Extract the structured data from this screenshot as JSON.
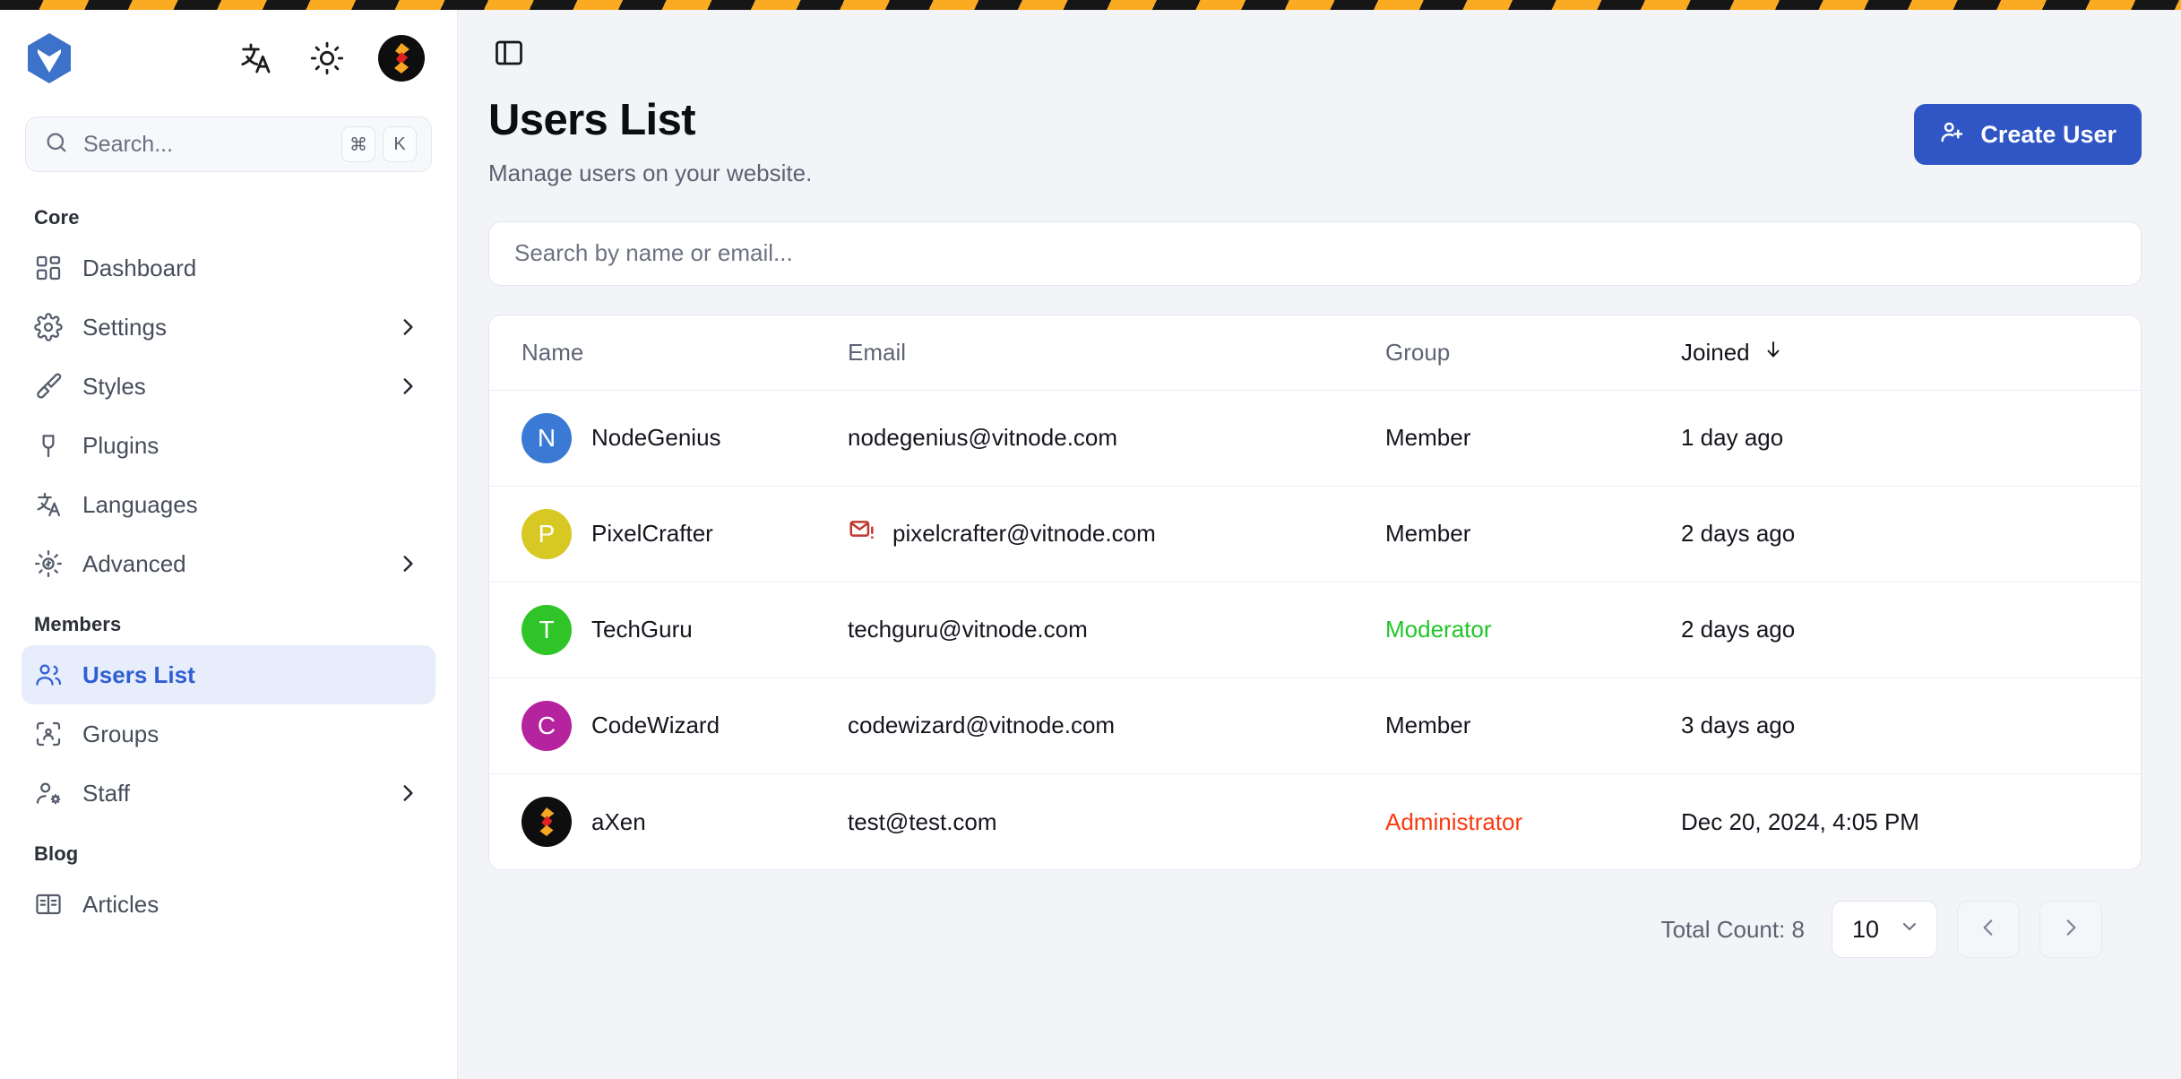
{
  "topbar": {
    "logo_icon": "vitnode-hexagon-logo",
    "translate_icon": "translate-icon",
    "theme_icon": "sun-icon",
    "avatar_icon": "user-avatar"
  },
  "sidebar": {
    "search": {
      "placeholder": "Search...",
      "kbd_mod": "⌘",
      "kbd_key": "K"
    },
    "groups": [
      {
        "label": "Core",
        "items": [
          {
            "label": "Dashboard",
            "icon": "layout-grid-icon",
            "active": false,
            "expandable": false
          },
          {
            "label": "Settings",
            "icon": "gear-icon",
            "active": false,
            "expandable": true
          },
          {
            "label": "Styles",
            "icon": "paintbrush-icon",
            "active": false,
            "expandable": true
          },
          {
            "label": "Plugins",
            "icon": "plug-icon",
            "active": false,
            "expandable": false
          },
          {
            "label": "Languages",
            "icon": "translate-icon",
            "active": false,
            "expandable": false
          },
          {
            "label": "Advanced",
            "icon": "cog-spokes-icon",
            "active": false,
            "expandable": true
          }
        ]
      },
      {
        "label": "Members",
        "items": [
          {
            "label": "Users List",
            "icon": "users-icon",
            "active": true,
            "expandable": false
          },
          {
            "label": "Groups",
            "icon": "group-frame-icon",
            "active": false,
            "expandable": false
          },
          {
            "label": "Staff",
            "icon": "user-cog-icon",
            "active": false,
            "expandable": true
          }
        ]
      },
      {
        "label": "Blog",
        "items": [
          {
            "label": "Articles",
            "icon": "book-open-icon",
            "active": false,
            "expandable": false
          }
        ]
      }
    ]
  },
  "main": {
    "panel_toggle_icon": "panel-left-icon",
    "title": "Users List",
    "subtitle": "Manage users on your website.",
    "create_button": {
      "label": "Create User",
      "icon": "user-plus-icon"
    },
    "search": {
      "placeholder": "Search by name or email..."
    }
  },
  "table": {
    "columns": [
      "Name",
      "Email",
      "Group",
      "Joined"
    ],
    "sort_column": "Joined",
    "sort_direction": "desc",
    "sort_icon": "arrow-down-icon",
    "action_icon": "eye-icon",
    "rows": [
      {
        "name": "NodeGenius",
        "initial": "N",
        "avatar_color": "#3b7ad4",
        "email": "nodegenius@vitnode.com",
        "email_warning": false,
        "group": "Member",
        "group_style": "member",
        "joined": "1 day ago"
      },
      {
        "name": "PixelCrafter",
        "initial": "P",
        "avatar_color": "#d8c824",
        "email": "pixelcrafter@vitnode.com",
        "email_warning": true,
        "email_warning_icon": "mail-warning-icon",
        "group": "Member",
        "group_style": "member",
        "joined": "2 days ago"
      },
      {
        "name": "TechGuru",
        "initial": "T",
        "avatar_color": "#2fc528",
        "email": "techguru@vitnode.com",
        "email_warning": false,
        "group": "Moderator",
        "group_style": "moderator",
        "joined": "2 days ago"
      },
      {
        "name": "CodeWizard",
        "initial": "C",
        "avatar_color": "#b5239e",
        "email": "codewizard@vitnode.com",
        "email_warning": false,
        "group": "Member",
        "group_style": "member",
        "joined": "3 days ago"
      },
      {
        "name": "aXen",
        "initial": "",
        "avatar_color": "#0e0e0e",
        "avatar_image": "axen-logo",
        "email": "test@test.com",
        "email_warning": false,
        "group": "Administrator",
        "group_style": "admin",
        "joined": "Dec 20, 2024, 4:05 PM"
      }
    ]
  },
  "pagination": {
    "total_label": "Total Count: 8",
    "page_size": "10",
    "prev_icon": "chevron-left-icon",
    "next_icon": "chevron-right-icon",
    "dropdown_icon": "chevron-down-icon"
  },
  "colors": {
    "accent": "#2f56c4",
    "active_nav_bg": "#e7edfb",
    "active_nav_text": "#2f5fd4",
    "moderator": "#22c52b",
    "administrator": "#f9390f",
    "warning": "#c0392f",
    "page_bg": "#f2f4f8"
  }
}
